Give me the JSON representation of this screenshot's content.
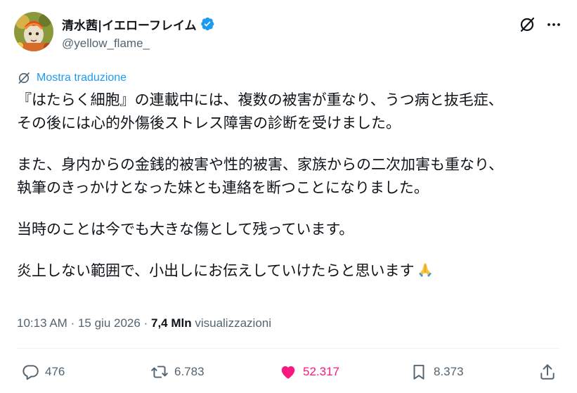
{
  "author": {
    "display_name": "清水茜|イエローフレイム",
    "handle": "@yellow_flame_",
    "verified": true
  },
  "header": {
    "grok_icon": "grok-icon",
    "more_icon": "more-dots-icon"
  },
  "translate": {
    "label": "Mostra traduzione",
    "icon": "grok-icon"
  },
  "tweet": {
    "paragraphs": [
      [
        "『はたらく細胞』の連載中には、複数の被害が重なり、うつ病と抜毛症、",
        "その後には心的外傷後ストレス障害の診断を受けました。"
      ],
      [
        "また、身内からの金銭的被害や性的被害、家族からの二次加害も重なり、",
        "執筆のきっかけとなった妹とも連絡を断つことになりました。"
      ],
      [
        "当時のことは今でも大きな傷として残っています。"
      ],
      [
        "炎上しない範囲で、小出しにお伝えしていけたらと思います"
      ]
    ],
    "emoji": "🙏"
  },
  "meta": {
    "time": "10:13 AM",
    "separator": "·",
    "date": "15 giu 2026",
    "views_count": "7,4 Mln",
    "views_label": "visualizzazioni"
  },
  "actions": {
    "replies": "476",
    "reposts": "6.783",
    "likes": "52.317",
    "bookmarks": "8.373",
    "liked": true
  },
  "colors": {
    "accent": "#1d9bf0",
    "like": "#f91880",
    "secondary_text": "#536471",
    "primary_text": "#0f1419"
  }
}
